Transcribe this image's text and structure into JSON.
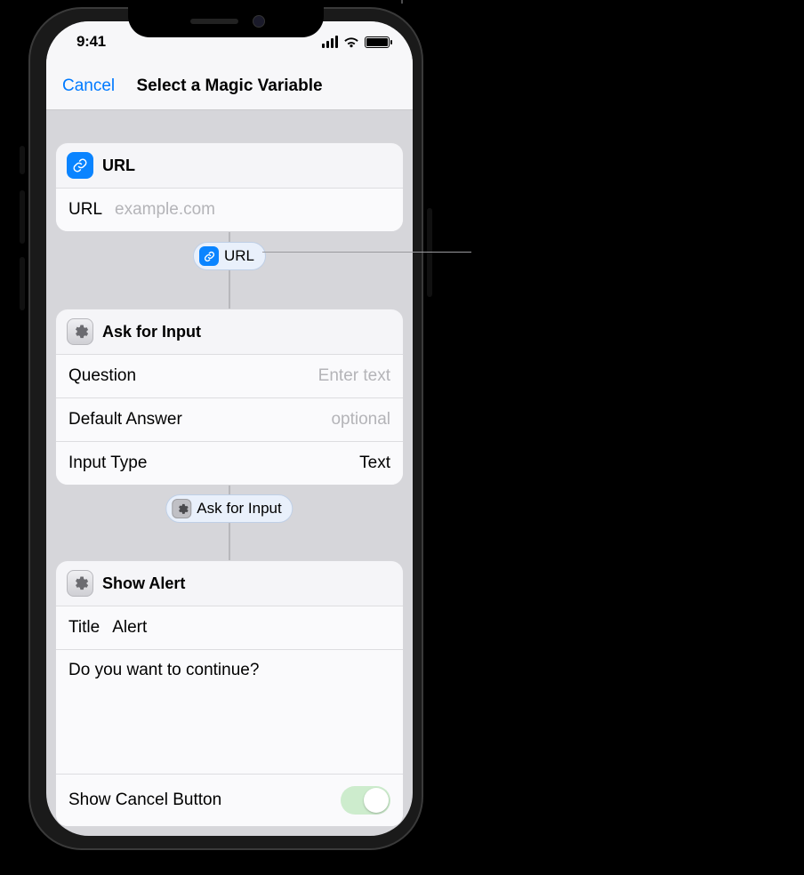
{
  "status": {
    "time": "9:41"
  },
  "nav": {
    "cancel": "Cancel",
    "title": "Select a Magic Variable"
  },
  "cards": {
    "url": {
      "title": "URL",
      "field_label": "URL",
      "field_placeholder": "example.com"
    },
    "ask": {
      "title": "Ask for Input",
      "question_label": "Question",
      "question_placeholder": "Enter text",
      "default_label": "Default Answer",
      "default_placeholder": "optional",
      "type_label": "Input Type",
      "type_value": "Text"
    },
    "alert": {
      "title": "Show Alert",
      "title_field_label": "Title",
      "title_field_value": "Alert",
      "body_value": "Do you want to continue?",
      "cancel_btn_label": "Show Cancel Button",
      "cancel_btn_on": true
    }
  },
  "pills": {
    "url": "URL",
    "ask": "Ask for Input"
  }
}
